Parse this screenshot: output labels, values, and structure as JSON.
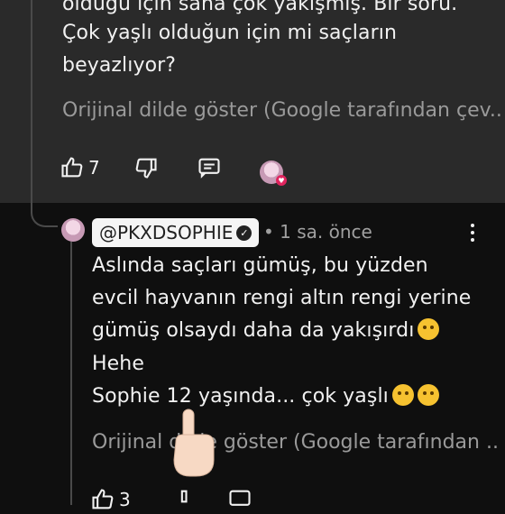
{
  "parent_comment": {
    "partial_line": "olduğu için sana çok yakışmış. Bir soru.",
    "lines": [
      "Çok yaşlı olduğun için mi saçların",
      "beyazlıyor?"
    ],
    "translate_label": "Orijinal dilde göster (Google tarafından çev...",
    "like_count": "7",
    "icons": [
      "thumb-up-icon",
      "thumb-down-icon",
      "reply-icon",
      "creator-heart-icon"
    ]
  },
  "reply": {
    "handle": "@PKXDSOPHIE",
    "time": "• 1 sa. önce",
    "lines": [
      "Aslında saçları gümüş, bu yüzden",
      "evcil hayvanın rengi altın rengi yerine",
      "gümüş olsaydı daha da yakışırdı",
      "Hehe",
      "Sophie 12 yaşında... çok yaşlı"
    ],
    "translate_label": "Orijinal dilde göster (Google tarafından ...",
    "like_count": "3",
    "colors": {
      "accent_bg": "#f5f5f5",
      "heart": "#e0245e"
    }
  }
}
